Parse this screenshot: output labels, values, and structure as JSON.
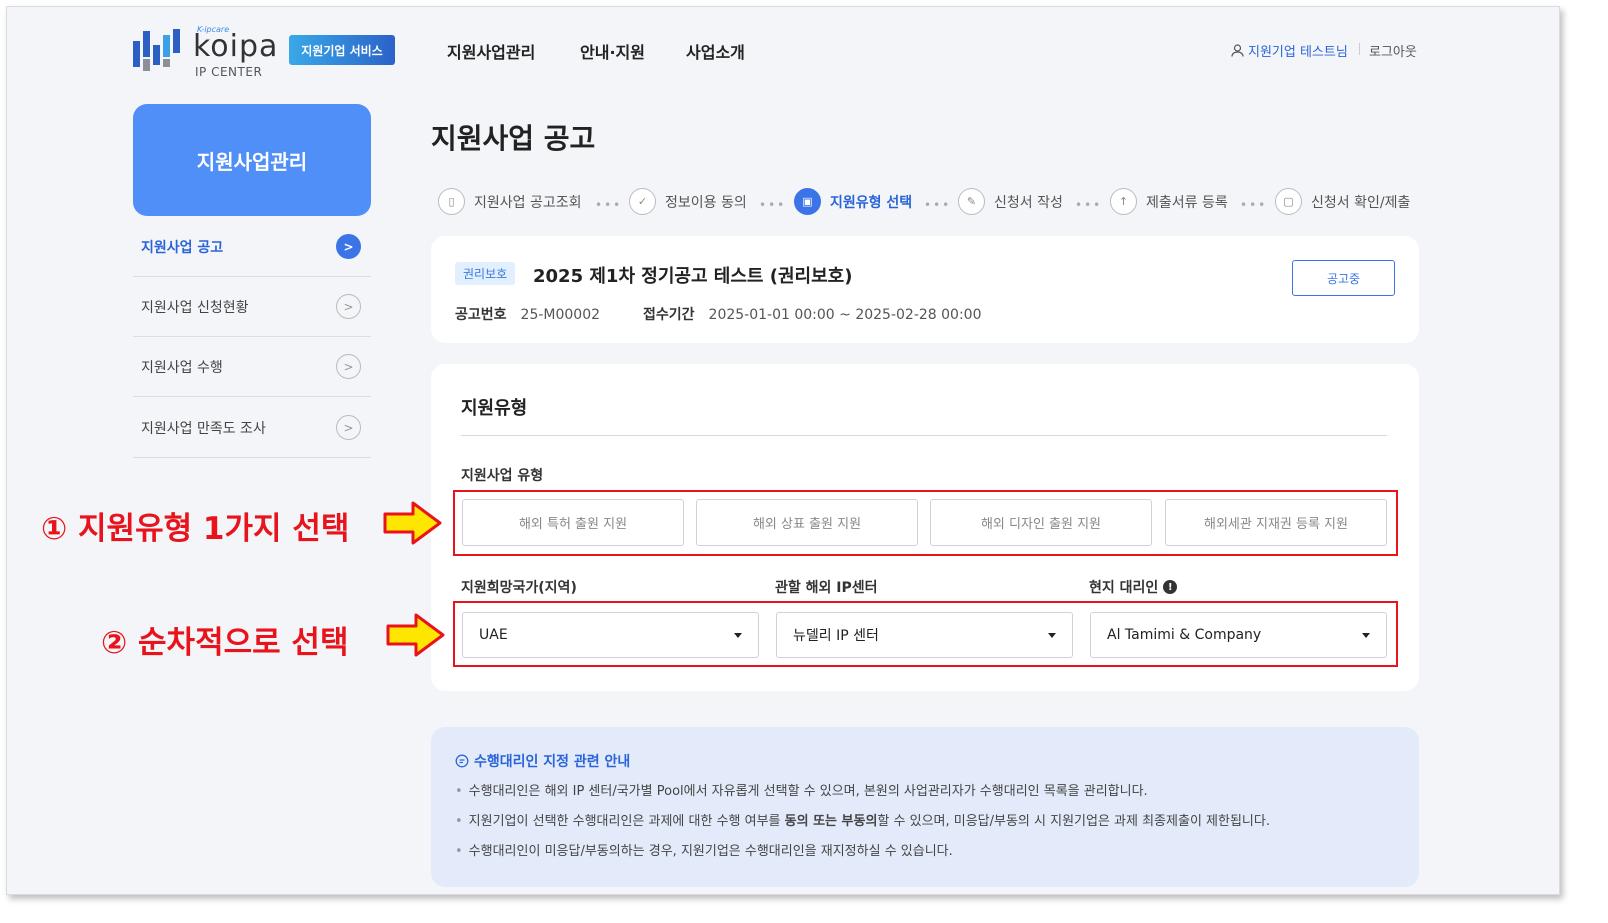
{
  "header": {
    "logo_brand_small": "K-ipcare",
    "logo_word": "koipa",
    "logo_sub": "IP CENTER",
    "service_badge": "지원기업 서비스",
    "nav": [
      "지원사업관리",
      "안내·지원",
      "사업소개"
    ],
    "user_label": "지원기업 테스트님",
    "logout": "로그아웃",
    "icons": {
      "user": "user-icon"
    }
  },
  "sidebar": {
    "title": "지원사업관리",
    "items": [
      {
        "label": "지원사업 공고",
        "active": true
      },
      {
        "label": "지원사업 신청현황",
        "active": false
      },
      {
        "label": "지원사업 수행",
        "active": false
      },
      {
        "label": "지원사업 만족도 조사",
        "active": false
      }
    ]
  },
  "page": {
    "title": "지원사업 공고"
  },
  "steps": [
    {
      "label": "지원사업 공고조회",
      "icon": "search-document-icon",
      "active": false
    },
    {
      "label": "정보이용 동의",
      "icon": "check-document-icon",
      "active": false
    },
    {
      "label": "지원유형 선택",
      "icon": "clipboard-icon",
      "active": true
    },
    {
      "label": "신청서 작성",
      "icon": "pencil-icon",
      "active": false
    },
    {
      "label": "제출서류 등록",
      "icon": "upload-icon",
      "active": false
    },
    {
      "label": "신청서 확인/제출",
      "icon": "document-icon",
      "active": false
    }
  ],
  "notice": {
    "tag": "권리보호",
    "title": "2025 제1차 정기공고 테스트 (권리보호)",
    "number_label": "공고번호",
    "number": "25-M00002",
    "period_label": "접수기간",
    "period": "2025-01-01 00:00 ~ 2025-02-28 00:00",
    "status": "공고중"
  },
  "support_type": {
    "section_title": "지원유형",
    "type_label": "지원사업 유형",
    "types": [
      "해외 특허 출원 지원",
      "해외 상표 출원 지원",
      "해외 디자인 출원 지원",
      "해외세관 지재권 등록 지원"
    ],
    "country_label": "지원희망국가(지역)",
    "country_value": "UAE",
    "center_label": "관할 해외 IP센터",
    "center_value": "뉴델리 IP 센터",
    "agent_label": "현지 대리인",
    "agent_value": "Al Tamimi & Company"
  },
  "annotations": {
    "first": "① 지원유형 1가지 선택",
    "second": "② 순차적으로 선택"
  },
  "guide": {
    "title": "수행대리인 지정 관련 안내",
    "line1": "수행대리인은 해외 IP 센터/국가별 Pool에서 자유롭게 선택할 수 있으며, 본원의 사업관리자가 수행대리인 목록을 관리합니다.",
    "line2_pre": "지원기업이 선택한 수행대리인은 과제에 대한 수행 여부를 ",
    "line2_bold": "동의 또는 부동의",
    "line2_post": "할 수 있으며, 미응답/부동의 시 지원기업은 과제 최종제출이 제한됩니다.",
    "line3": "수행대리인이 미응답/부동의하는 경우, 지원기업은 수행대리인을 재지정하실 수 있습니다."
  },
  "colors": {
    "accent": "#3b74e6",
    "annotation_red": "#e8131b",
    "arrow_yellow": "#ffe600"
  }
}
